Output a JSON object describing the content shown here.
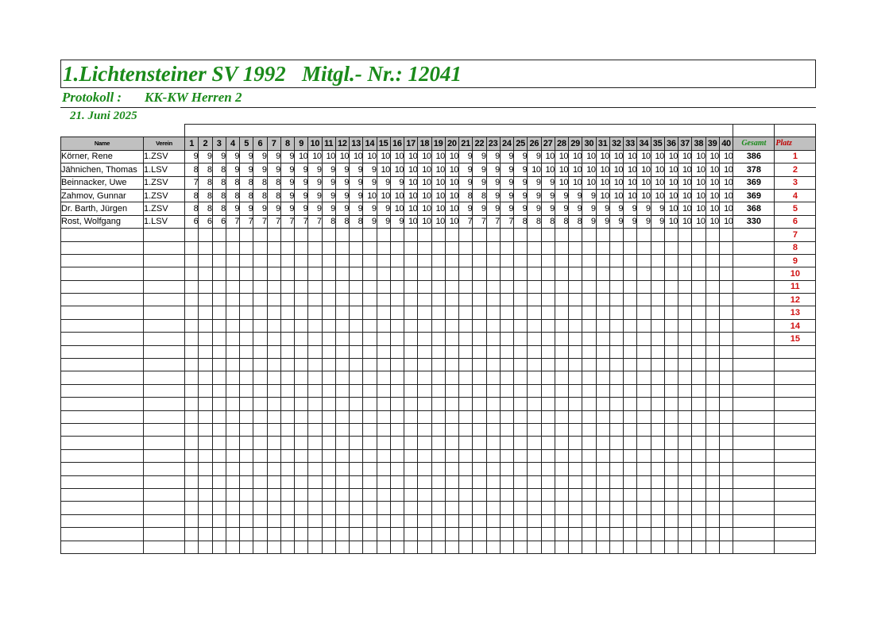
{
  "header": {
    "title": "1.Lichtensteiner SV 1992   Mitgl.- Nr.: 12041",
    "protocol_label": "Protokoll :",
    "protocol_value": "KK-KW Herren 2",
    "date": "21. Juni 2025"
  },
  "columns": {
    "name": "Name",
    "club": "Verein",
    "shots": [
      "1",
      "2",
      "3",
      "4",
      "5",
      "6",
      "7",
      "8",
      "9",
      "10",
      "11",
      "12",
      "13",
      "14",
      "15",
      "16",
      "17",
      "18",
      "19",
      "20",
      "21",
      "22",
      "23",
      "24",
      "25",
      "26",
      "27",
      "28",
      "29",
      "30",
      "31",
      "32",
      "33",
      "34",
      "35",
      "36",
      "37",
      "38",
      "39",
      "40"
    ],
    "total": "Gesamt",
    "rank": "Platz"
  },
  "rows": [
    {
      "name": "Körner, Rene",
      "club": "1.ZSV",
      "total": "386",
      "rank": "1",
      "shots": [
        "9",
        "9",
        "9",
        "9",
        "9",
        "9",
        "9",
        "9",
        "10",
        "10",
        "10",
        "10",
        "10",
        "10",
        "10",
        "10",
        "10",
        "10",
        "10",
        "10",
        "9",
        "9",
        "9",
        "9",
        "9",
        "9",
        "10",
        "10",
        "10",
        "10",
        "10",
        "10",
        "10",
        "10",
        "10",
        "10",
        "10",
        "10",
        "10",
        "10"
      ]
    },
    {
      "name": "Jähnichen, Thomas",
      "club": "1.LSV",
      "total": "378",
      "rank": "2",
      "shots": [
        "8",
        "8",
        "8",
        "9",
        "9",
        "9",
        "9",
        "9",
        "9",
        "9",
        "9",
        "9",
        "9",
        "9",
        "10",
        "10",
        "10",
        "10",
        "10",
        "10",
        "9",
        "9",
        "9",
        "9",
        "9",
        "10",
        "10",
        "10",
        "10",
        "10",
        "10",
        "10",
        "10",
        "10",
        "10",
        "10",
        "10",
        "10",
        "10",
        "10"
      ]
    },
    {
      "name": "Beinnacker, Uwe",
      "club": "1.ZSV",
      "total": "369",
      "rank": "3",
      "shots": [
        "7",
        "8",
        "8",
        "8",
        "8",
        "8",
        "8",
        "9",
        "9",
        "9",
        "9",
        "9",
        "9",
        "9",
        "9",
        "9",
        "10",
        "10",
        "10",
        "10",
        "9",
        "9",
        "9",
        "9",
        "9",
        "9",
        "9",
        "10",
        "10",
        "10",
        "10",
        "10",
        "10",
        "10",
        "10",
        "10",
        "10",
        "10",
        "10",
        "10"
      ]
    },
    {
      "name": "Zahmov, Gunnar",
      "club": "1.ZSV",
      "total": "369",
      "rank": "4",
      "shots": [
        "8",
        "8",
        "8",
        "8",
        "8",
        "8",
        "8",
        "9",
        "9",
        "9",
        "9",
        "9",
        "9",
        "10",
        "10",
        "10",
        "10",
        "10",
        "10",
        "10",
        "8",
        "8",
        "9",
        "9",
        "9",
        "9",
        "9",
        "9",
        "9",
        "9",
        "10",
        "10",
        "10",
        "10",
        "10",
        "10",
        "10",
        "10",
        "10",
        "10"
      ]
    },
    {
      "name": "Dr. Barth, Jürgen",
      "club": "1.ZSV",
      "total": "368",
      "rank": "5",
      "shots": [
        "8",
        "8",
        "8",
        "9",
        "9",
        "9",
        "9",
        "9",
        "9",
        "9",
        "9",
        "9",
        "9",
        "9",
        "9",
        "10",
        "10",
        "10",
        "10",
        "10",
        "9",
        "9",
        "9",
        "9",
        "9",
        "9",
        "9",
        "9",
        "9",
        "9",
        "9",
        "9",
        "9",
        "9",
        "9",
        "10",
        "10",
        "10",
        "10",
        "10"
      ]
    },
    {
      "name": "Rost, Wolfgang",
      "club": "1.LSV",
      "total": "330",
      "rank": "6",
      "shots": [
        "6",
        "6",
        "6",
        "7",
        "7",
        "7",
        "7",
        "7",
        "7",
        "7",
        "8",
        "8",
        "8",
        "9",
        "9",
        "9",
        "10",
        "10",
        "10",
        "10",
        "7",
        "7",
        "7",
        "7",
        "8",
        "8",
        "8",
        "8",
        "8",
        "9",
        "9",
        "9",
        "9",
        "9",
        "9",
        "10",
        "10",
        "10",
        "10",
        "10"
      ]
    }
  ],
  "empty_ranks": [
    "7",
    "8",
    "9",
    "10",
    "11",
    "12",
    "13",
    "14",
    "15"
  ]
}
